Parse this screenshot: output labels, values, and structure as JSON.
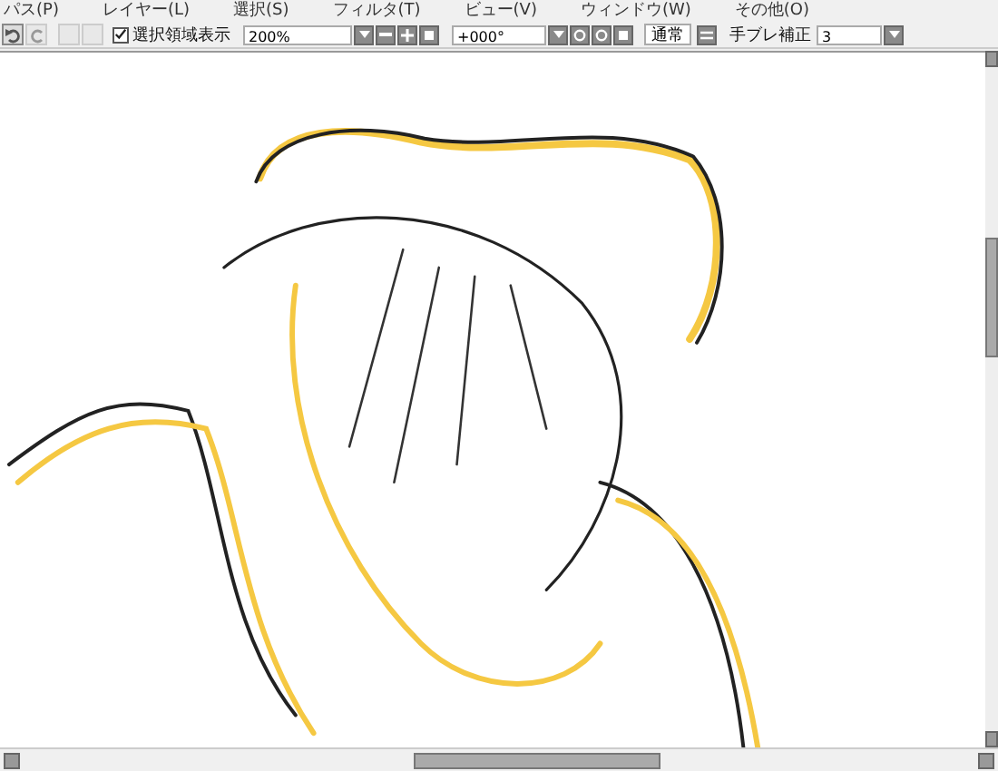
{
  "menu": [
    "パス(P)",
    "レイヤー(L)",
    "選択(S)",
    "フィルタ(T)",
    "ビュー(V)",
    "ウィンドウ(W)",
    "その他(O)"
  ],
  "toolbar": {
    "undo_disabled": false,
    "redo_disabled": true,
    "selection_display": {
      "label": "選択領域表示",
      "checked": true
    },
    "zoom": "200%",
    "rotation": "+000°",
    "blend_mode": "通常",
    "stabilizer": {
      "label": "手ブレ補正",
      "value": "3"
    }
  }
}
